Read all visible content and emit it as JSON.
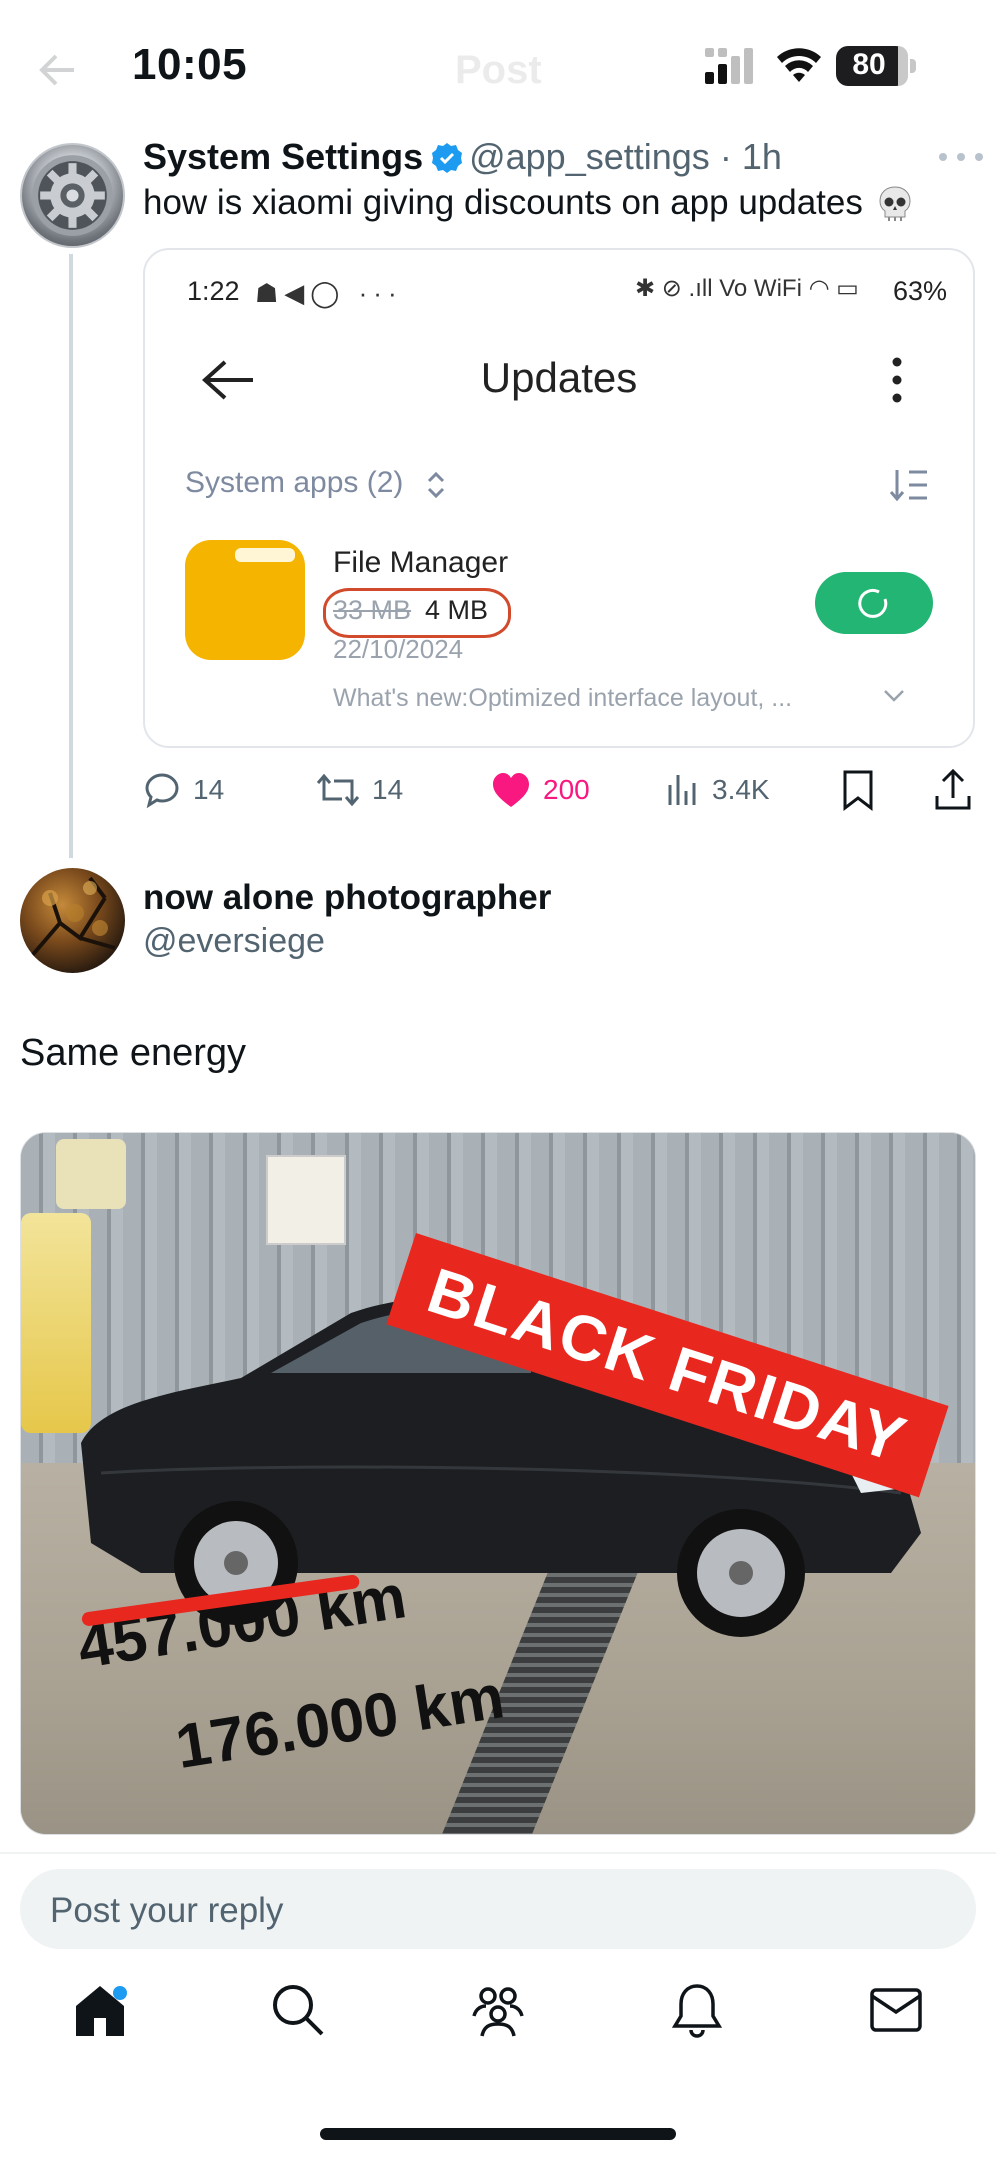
{
  "status_bar": {
    "time": "10:05",
    "battery": "80",
    "ghost_title": "Post"
  },
  "tweet1": {
    "name": "System Settings",
    "handle": "@app_settings",
    "separator": "·",
    "age": "1h",
    "text": "how is xiaomi giving discounts on app updates",
    "avatar_icon": "gear-icon",
    "embedded": {
      "time": "1:22",
      "left_status_icons": "☗◀◯ ···",
      "right_status_icons": "✱ ⊘ .ıll Vo WiFi ◠ ▭",
      "battery_pct": "63%",
      "title": "Updates",
      "section_label": "System apps (2)",
      "app_name": "File Manager",
      "old_size": "33 MB",
      "new_size": "4 MB",
      "date": "22/10/2024",
      "whats_new": "What's new:Optimized interface layout, ...",
      "accent_green": "#22b573",
      "circle_red": "#d24a2c"
    },
    "actions": {
      "replies": "14",
      "reposts": "14",
      "likes": "200",
      "views": "3.4K"
    }
  },
  "tweet2": {
    "name": "now alone photographer",
    "handle": "@eversiege",
    "text": "Same energy",
    "image": {
      "banner": "BLACK FRIDAY",
      "old_km": "457.000 km",
      "new_km": "176.000 km"
    }
  },
  "reply": {
    "placeholder": "Post your reply"
  },
  "tabbar": {
    "items": [
      "home-icon",
      "search-icon",
      "communities-icon",
      "notifications-icon",
      "messages-icon"
    ]
  }
}
